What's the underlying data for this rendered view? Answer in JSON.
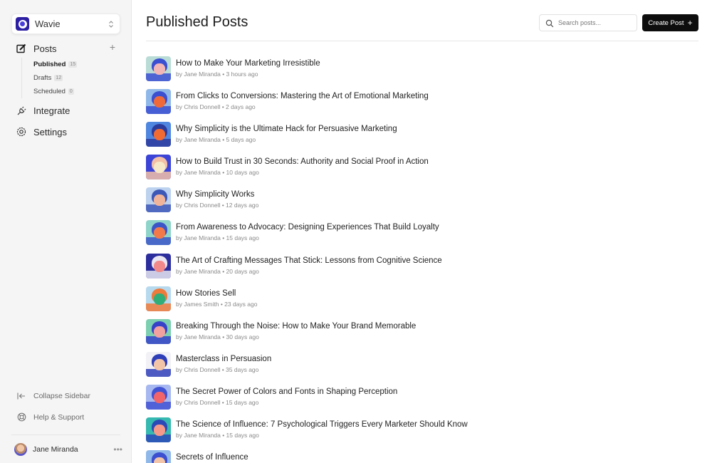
{
  "workspace": {
    "name": "Wavie",
    "brand_color": "#2d1fa3"
  },
  "sidebar": {
    "posts_label": "Posts",
    "add_post_icon": "plus-icon",
    "sub_items": [
      {
        "label": "Published",
        "count": "15",
        "active": true
      },
      {
        "label": "Drafts",
        "count": "12",
        "active": false
      },
      {
        "label": "Scheduled",
        "count": "0",
        "active": false
      }
    ],
    "integrate_label": "Integrate",
    "settings_label": "Settings",
    "collapse_label": "Collapse Sidebar",
    "help_label": "Help & Support",
    "user": {
      "name": "Jane Miranda",
      "more_icon": "ellipsis-icon"
    }
  },
  "header": {
    "title": "Published Posts",
    "search_placeholder": "Search posts...",
    "search_value": "",
    "create_label": "Create Post",
    "create_icon": "+"
  },
  "posts": [
    {
      "title": "How to Make Your Marketing Irresistible",
      "author": "Jane Miranda",
      "time": "3 hours ago",
      "meta": "by Jane Miranda • 3 hours ago",
      "thumb": [
        "#b9dcd6",
        "#3a4fd1",
        "#f2b6b6"
      ]
    },
    {
      "title": "From Clicks to Conversions: Mastering the Art of Emotional Marketing",
      "author": "Chris Donnell",
      "time": "2 days ago",
      "meta": "by Chris Donnell • 2 days ago",
      "thumb": [
        "#8fb8e8",
        "#3b4fd0",
        "#ee6a3a"
      ]
    },
    {
      "title": "Why Simplicity is the Ultimate Hack for Persuasive Marketing",
      "author": "Jane Miranda",
      "time": "5 days ago",
      "meta": "by Jane Miranda • 5 days ago",
      "thumb": [
        "#4f86e0",
        "#2b3b9c",
        "#f06a34"
      ]
    },
    {
      "title": "How to Build Trust in 30 Seconds: Authority and Social Proof in Action",
      "author": "Jane Miranda",
      "time": "10 days ago",
      "meta": "by Jane Miranda • 10 days ago",
      "thumb": [
        "#3b44d6",
        "#f3c0a6",
        "#f4e8c8"
      ]
    },
    {
      "title": "Why Simplicity Works",
      "author": "Chris Donnell",
      "time": "12 days ago",
      "meta": "by Chris Donnell • 12 days ago",
      "thumb": [
        "#bcd2ee",
        "#3e58b8",
        "#f0b49a"
      ]
    },
    {
      "title": "From Awareness to Advocacy: Designing Experiences That Build Loyalty",
      "author": "Jane Miranda",
      "time": "15 days ago",
      "meta": "by Jane Miranda • 15 days ago",
      "thumb": [
        "#8fd4c9",
        "#3c56c8",
        "#f27a4a"
      ]
    },
    {
      "title": "The Art of Crafting Messages That Stick: Lessons from Cognitive Science",
      "author": "Jane Miranda",
      "time": "20 days ago",
      "meta": "by Jane Miranda • 20 days ago",
      "thumb": [
        "#2c2e9e",
        "#e9e6f2",
        "#f08a8a"
      ]
    },
    {
      "title": "How Stories Sell",
      "author": "James Smith",
      "time": "23 days ago",
      "meta": "by James Smith • 23 days ago",
      "thumb": [
        "#b7d9ee",
        "#ee7a3c",
        "#2fae7a"
      ]
    },
    {
      "title": "Breaking Through the Noise: How to Make Your Brand Memorable",
      "author": "Jane Miranda",
      "time": "30 days ago",
      "meta": "by Jane Miranda • 30 days ago",
      "thumb": [
        "#7ccfb0",
        "#3742c9",
        "#f2a0a0"
      ]
    },
    {
      "title": "Masterclass in Persuasion",
      "author": "Chris Donnell",
      "time": "35 days ago",
      "meta": "by Chris Donnell • 35 days ago",
      "thumb": [
        "#f1f1f6",
        "#2f3fb8",
        "#f2c4a8"
      ]
    },
    {
      "title": "The Secret Power of Colors and Fonts in Shaping Perception",
      "author": "Chris Donnell",
      "time": "15 days ago",
      "meta": "by Chris Donnell • 15 days ago",
      "thumb": [
        "#a7b8f0",
        "#4252d4",
        "#f0646a"
      ]
    },
    {
      "title": "The Science of Influence: 7 Psychological Triggers Every Marketer Should Know",
      "author": "Jane Miranda",
      "time": "15 days ago",
      "meta": "by Jane Miranda • 15 days ago",
      "thumb": [
        "#36b9b0",
        "#2c49b8",
        "#f59a8a"
      ]
    },
    {
      "title": "Secrets of Influence",
      "author": "",
      "time": "",
      "meta": "",
      "thumb": [
        "#8fb8e8",
        "#3b4fd0",
        "#f2c4a8"
      ]
    }
  ]
}
